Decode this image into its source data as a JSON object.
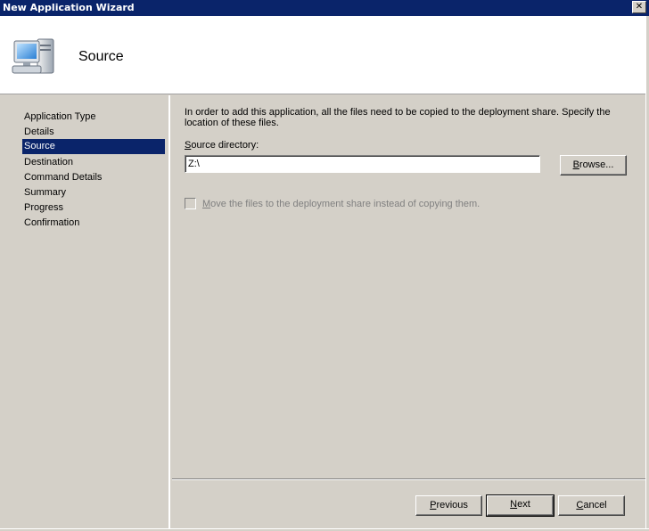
{
  "window": {
    "title": "New Application Wizard",
    "close_glyph": "✕"
  },
  "header": {
    "title": "Source",
    "icon": "computer-icon"
  },
  "steps": [
    {
      "label": "Application Type",
      "active": false
    },
    {
      "label": "Details",
      "active": false
    },
    {
      "label": "Source",
      "active": true
    },
    {
      "label": "Destination",
      "active": false
    },
    {
      "label": "Command Details",
      "active": false
    },
    {
      "label": "Summary",
      "active": false
    },
    {
      "label": "Progress",
      "active": false
    },
    {
      "label": "Confirmation",
      "active": false
    }
  ],
  "main": {
    "description": "In order to add this application, all the files need to be copied to the deployment share.  Specify the location of these files.",
    "source_label_first": "S",
    "source_label_rest": "ource directory:",
    "source_value": "Z:\\",
    "browse_first": "B",
    "browse_rest": "rowse...",
    "checkbox_first": "M",
    "checkbox_rest": "ove the files to the deployment share instead of copying them.",
    "checkbox_checked": false,
    "checkbox_enabled": false
  },
  "footer": {
    "previous_first": "P",
    "previous_rest": "revious",
    "next_first": "N",
    "next_rest": "ext",
    "cancel_first": "C",
    "cancel_rest": "ancel"
  },
  "colors": {
    "titlebar": "#0a246a",
    "selection": "#0a246a",
    "face": "#d4d0c8",
    "disabled_text": "#808080"
  }
}
